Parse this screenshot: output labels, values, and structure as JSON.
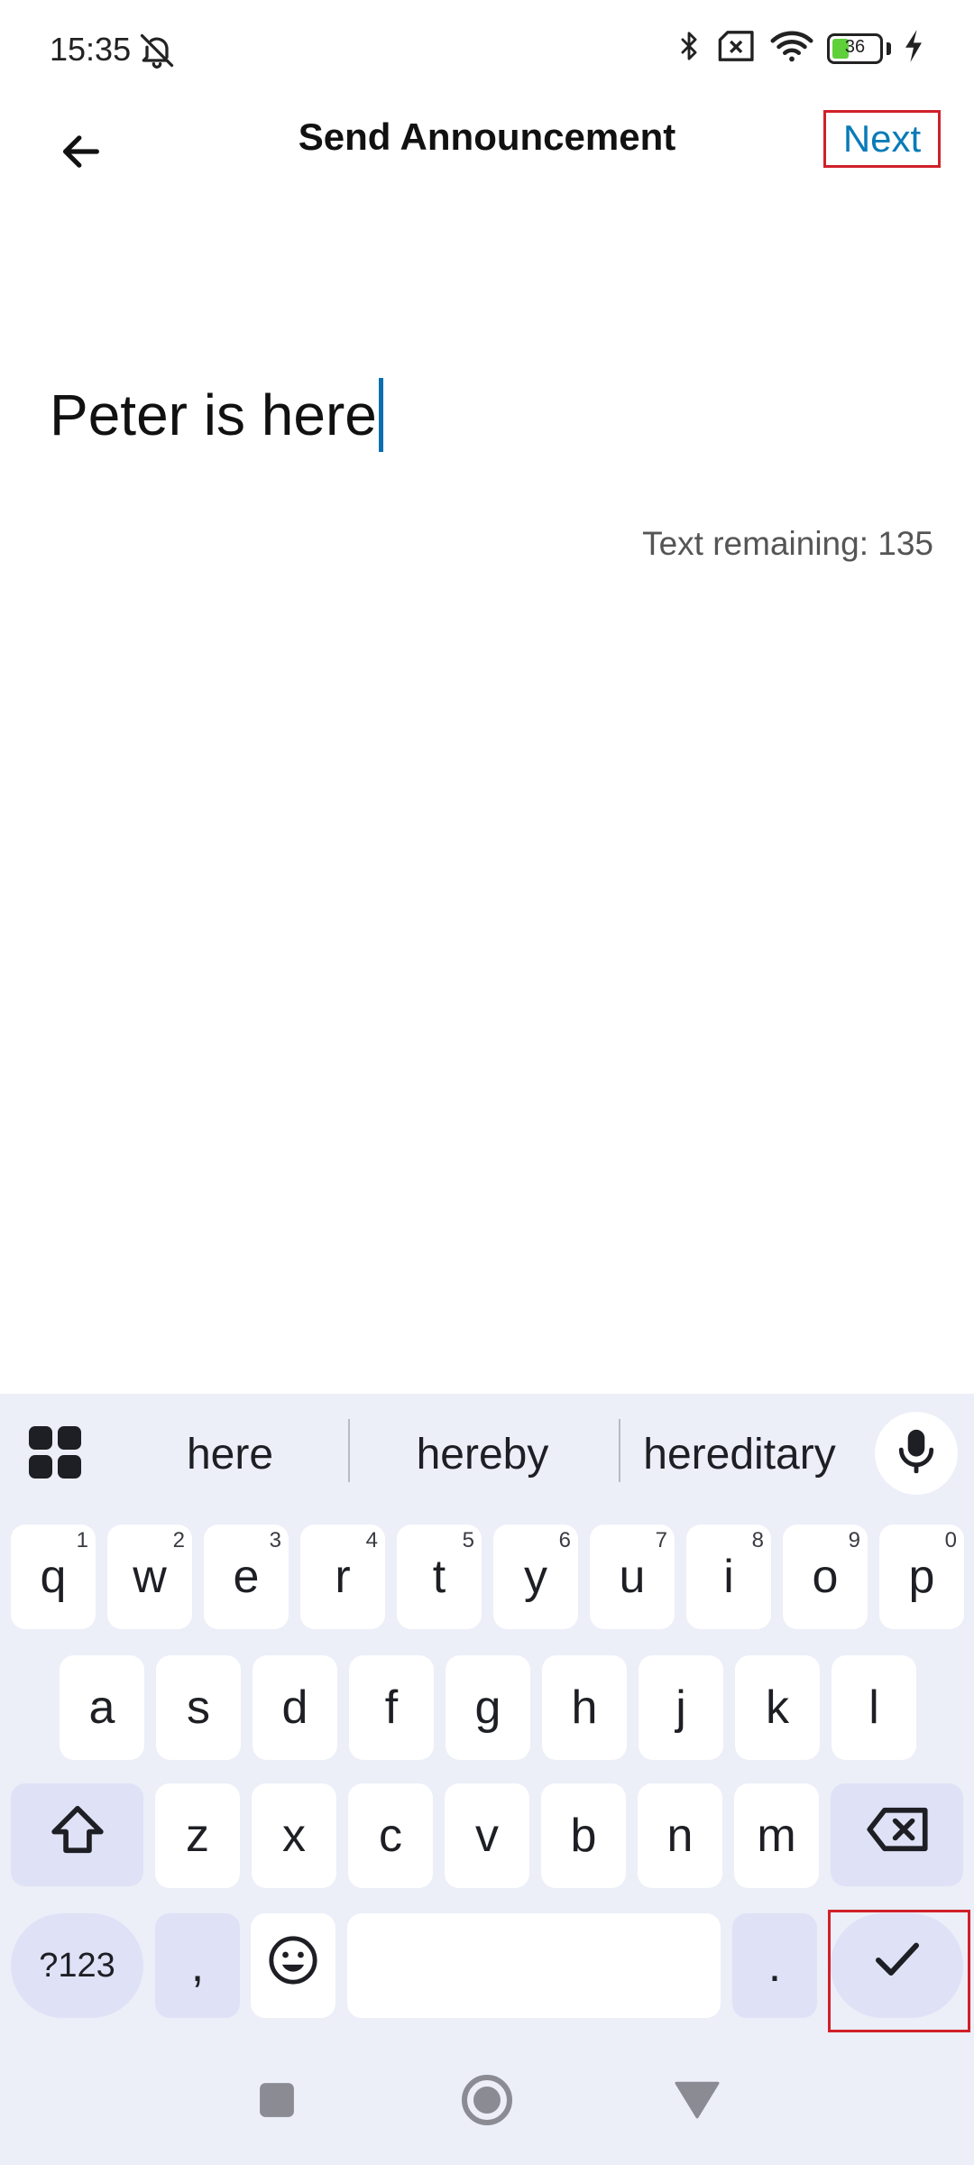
{
  "status_bar": {
    "time": "15:35",
    "battery": "36",
    "battery_level": 0.36
  },
  "app_bar": {
    "title": "Send Announcement",
    "next_label": "Next"
  },
  "message": {
    "text": "Peter is here",
    "remaining": "Text remaining: 135"
  },
  "keyboard": {
    "suggestions": [
      "here",
      "hereby",
      "hereditary"
    ],
    "row1": [
      {
        "key": "q",
        "hint": "1"
      },
      {
        "key": "w",
        "hint": "2"
      },
      {
        "key": "e",
        "hint": "3"
      },
      {
        "key": "r",
        "hint": "4"
      },
      {
        "key": "t",
        "hint": "5"
      },
      {
        "key": "y",
        "hint": "6"
      },
      {
        "key": "u",
        "hint": "7"
      },
      {
        "key": "i",
        "hint": "8"
      },
      {
        "key": "o",
        "hint": "9"
      },
      {
        "key": "p",
        "hint": "0"
      }
    ],
    "row2": [
      "a",
      "s",
      "d",
      "f",
      "g",
      "h",
      "j",
      "k",
      "l"
    ],
    "row3": [
      "z",
      "x",
      "c",
      "v",
      "b",
      "n",
      "m"
    ],
    "symbols_label": "?123",
    "comma": ",",
    "period": "."
  },
  "icons": {
    "back": "arrow-left-icon",
    "mute": "bell-off-icon",
    "bluetooth": "bluetooth-icon",
    "no_sim": "sim-off-icon",
    "wifi": "wifi-icon",
    "charging": "bolt-icon",
    "apps": "grid-icon",
    "mic": "mic-icon",
    "shift": "shift-icon",
    "backspace": "backspace-icon",
    "emoji": "emoji-icon",
    "enter": "check-icon",
    "recents": "square-icon",
    "home": "circle-icon",
    "back_nav": "triangle-icon"
  },
  "colors": {
    "accent": "#0a7bb8",
    "highlight": "#d0202a",
    "keyboard_bg": "#eceef8",
    "func_key": "#dfe2f6"
  }
}
